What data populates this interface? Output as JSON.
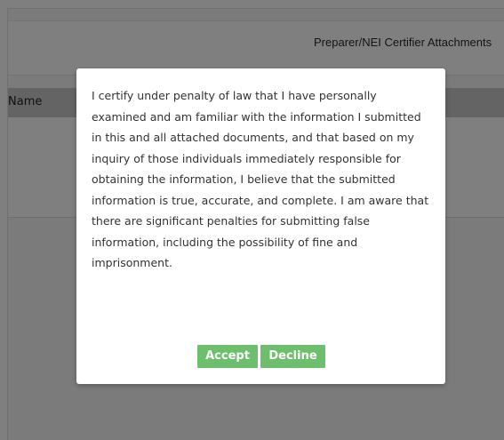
{
  "background_page": {
    "header_title": "Preparer/NEI Certifier Attachments",
    "table_header_label": "Name"
  },
  "modal": {
    "certification_text": "I certify under penalty of law that I have personally examined and am familiar with the information I submitted in this and all attached documents, and that based on my inquiry of those individuals immediately responsible for obtaining the information, I believe that the submitted information is true, accurate, and complete. I am aware that there are significant penalties for submitting false information, including the possibility of fine and imprisonment.",
    "accept_label": "Accept",
    "decline_label": "Decline"
  },
  "colors": {
    "button_bg": "#6dbf6d",
    "overlay": "rgba(0,0,0,0.5)"
  }
}
